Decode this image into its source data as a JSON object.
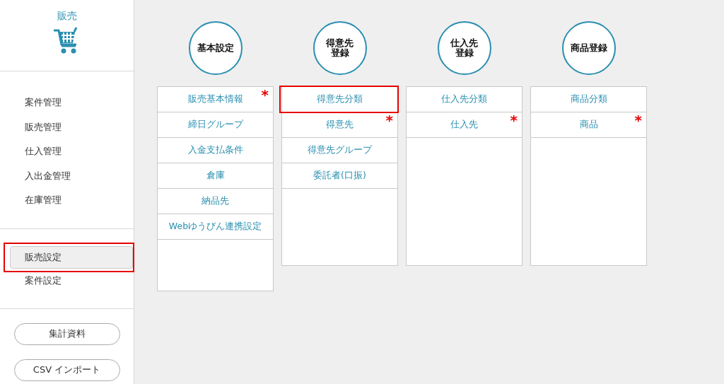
{
  "sidebar": {
    "title": "販売",
    "menu": [
      {
        "label": "案件管理",
        "selected": false
      },
      {
        "label": "販売管理",
        "selected": false
      },
      {
        "label": "仕入管理",
        "selected": false
      },
      {
        "label": "入出金管理",
        "selected": false
      },
      {
        "label": "在庫管理",
        "selected": false
      }
    ],
    "settings": [
      {
        "label": "販売設定",
        "selected": true,
        "highlighted": true
      },
      {
        "label": "案件設定",
        "selected": false,
        "highlighted": false
      }
    ],
    "buttons": [
      "集計資料",
      "CSV インポート"
    ]
  },
  "columns": [
    {
      "heading": [
        "基本設定"
      ],
      "items": [
        {
          "label": "販売基本情報",
          "required_mark": "*",
          "highlighted": false
        },
        {
          "label": "締日グループ",
          "highlighted": false
        },
        {
          "label": "入金支払条件",
          "highlighted": false
        },
        {
          "label": "倉庫",
          "highlighted": false
        },
        {
          "label": "納品先",
          "highlighted": false
        },
        {
          "label": "Webゆうびん連携設定",
          "highlighted": false
        }
      ]
    },
    {
      "heading": [
        "得意先",
        "登録"
      ],
      "items": [
        {
          "label": "得意先分類",
          "highlighted": true
        },
        {
          "label": "得意先",
          "required_mark": "*",
          "highlighted": false
        },
        {
          "label": "得意先グループ",
          "highlighted": false
        },
        {
          "label": "委託者(口振)",
          "highlighted": false
        }
      ]
    },
    {
      "heading": [
        "仕入先",
        "登録"
      ],
      "items": [
        {
          "label": "仕入先分類",
          "highlighted": false
        },
        {
          "label": "仕入先",
          "required_mark": "*",
          "highlighted": false
        }
      ]
    },
    {
      "heading": [
        "商品登録"
      ],
      "items": [
        {
          "label": "商品分類",
          "highlighted": false
        },
        {
          "label": "商品",
          "required_mark": "*",
          "highlighted": false
        }
      ]
    }
  ]
}
